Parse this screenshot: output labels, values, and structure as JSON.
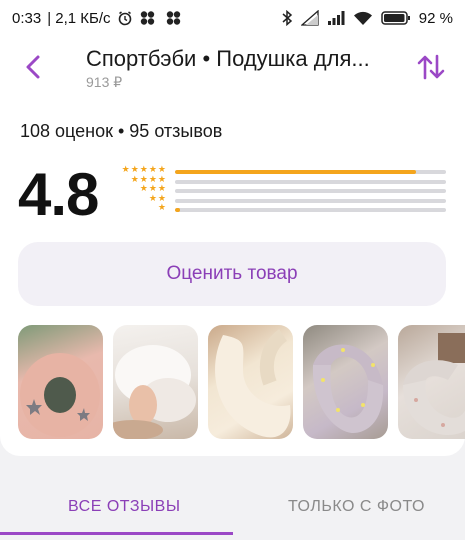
{
  "status_bar": {
    "time": "0:33",
    "speed": "| 2,1 КБ/с",
    "battery": "92 %"
  },
  "header": {
    "title": "Спортбэби • Подушка для...",
    "price": "913 ₽"
  },
  "rating": {
    "counts": "108 оценок • 95 отзывов",
    "average": "4.8",
    "distribution": [
      {
        "stars": 5,
        "fraction": 0.89
      },
      {
        "stars": 4,
        "fraction": 0.0
      },
      {
        "stars": 3,
        "fraction": 0.0
      },
      {
        "stars": 2,
        "fraction": 0.0
      },
      {
        "stars": 1,
        "fraction": 0.01
      }
    ],
    "star_color": "#f4a51c",
    "track_color": "#d8d8dc"
  },
  "rate_button": "Оценить товар",
  "photos": [
    "photo-pink-pillow",
    "photo-filling",
    "photo-cream-pillow",
    "photo-star-pillow",
    "photo-grey-pillow"
  ],
  "tabs": {
    "all": "ВСЕ ОТЗЫВЫ",
    "with_photo": "ТОЛЬКО С ФОТО"
  },
  "accent_color": "#8b3fb7"
}
